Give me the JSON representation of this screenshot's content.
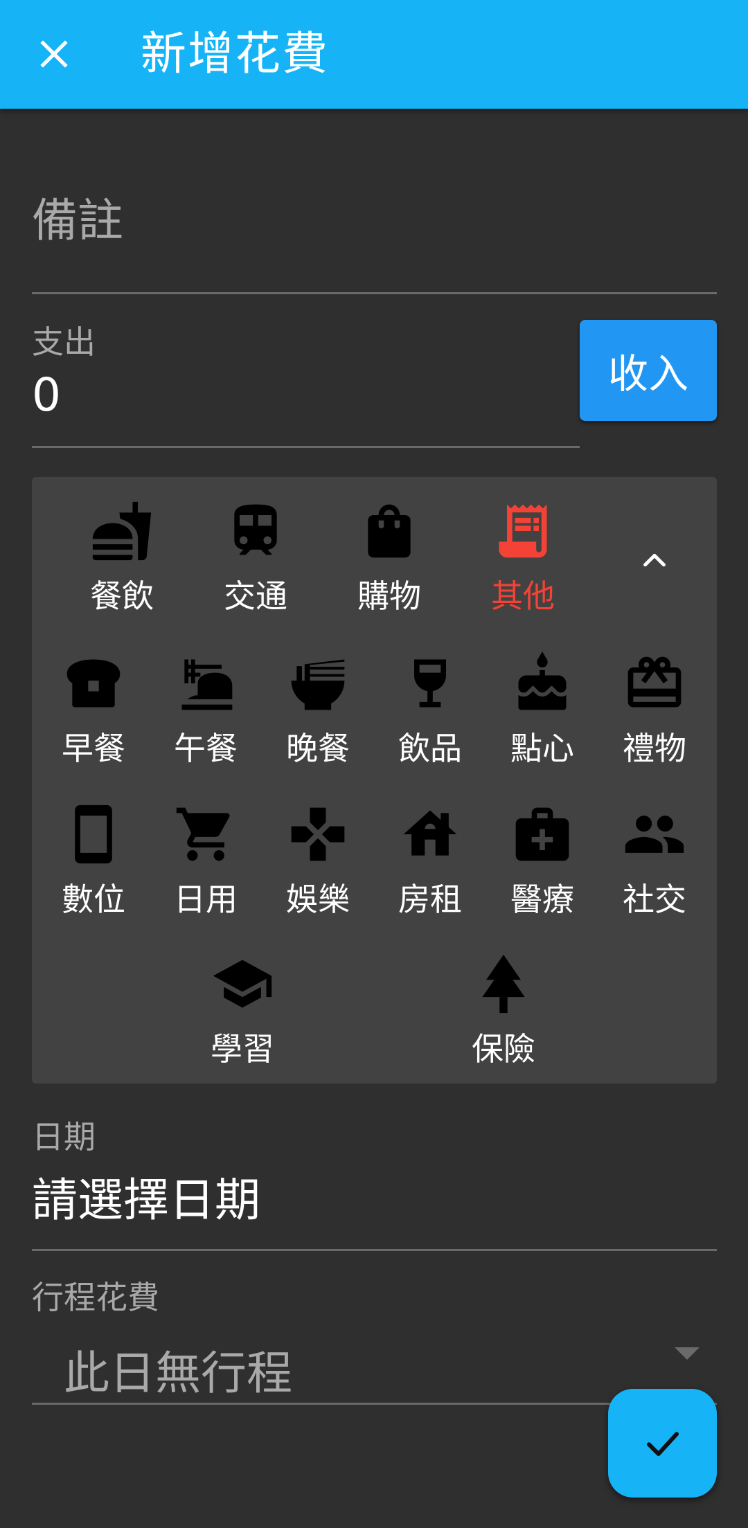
{
  "header": {
    "title": "新增花費",
    "close_icon": "close-icon"
  },
  "note": {
    "placeholder": "備註"
  },
  "amount": {
    "label": "支出",
    "value": "0",
    "toggle_label": "收入"
  },
  "categories": {
    "selected": "其他",
    "accent_color": "#f44336",
    "main": [
      {
        "label": "餐飲",
        "icon": "fastfood-icon"
      },
      {
        "label": "交通",
        "icon": "train-icon"
      },
      {
        "label": "購物",
        "icon": "shopping-bag-icon"
      },
      {
        "label": "其他",
        "icon": "receipt-icon"
      }
    ],
    "sub_row1": [
      {
        "label": "早餐",
        "icon": "bread-icon"
      },
      {
        "label": "午餐",
        "icon": "bento-icon"
      },
      {
        "label": "晚餐",
        "icon": "noodle-bowl-icon"
      },
      {
        "label": "飲品",
        "icon": "wine-glass-icon"
      },
      {
        "label": "點心",
        "icon": "cake-icon"
      },
      {
        "label": "禮物",
        "icon": "gift-card-icon"
      }
    ],
    "sub_row2": [
      {
        "label": "數位",
        "icon": "smartphone-icon"
      },
      {
        "label": "日用",
        "icon": "shopping-cart-icon"
      },
      {
        "label": "娛樂",
        "icon": "gamepad-icon"
      },
      {
        "label": "房租",
        "icon": "house-icon"
      },
      {
        "label": "醫療",
        "icon": "medical-bag-icon"
      },
      {
        "label": "社交",
        "icon": "people-icon"
      }
    ],
    "sub_row3": [
      {
        "label": "學習",
        "icon": "school-cap-icon"
      },
      {
        "label": "保險",
        "icon": "pine-tree-icon"
      }
    ]
  },
  "date": {
    "label": "日期",
    "value": "請選擇日期"
  },
  "trip": {
    "label": "行程花費",
    "value": "此日無行程"
  },
  "fab": {
    "icon": "check-icon"
  },
  "colors": {
    "app_bar": "#16b4f7",
    "background": "#2f2f2f",
    "panel": "#424242",
    "income_button": "#2196f3"
  }
}
